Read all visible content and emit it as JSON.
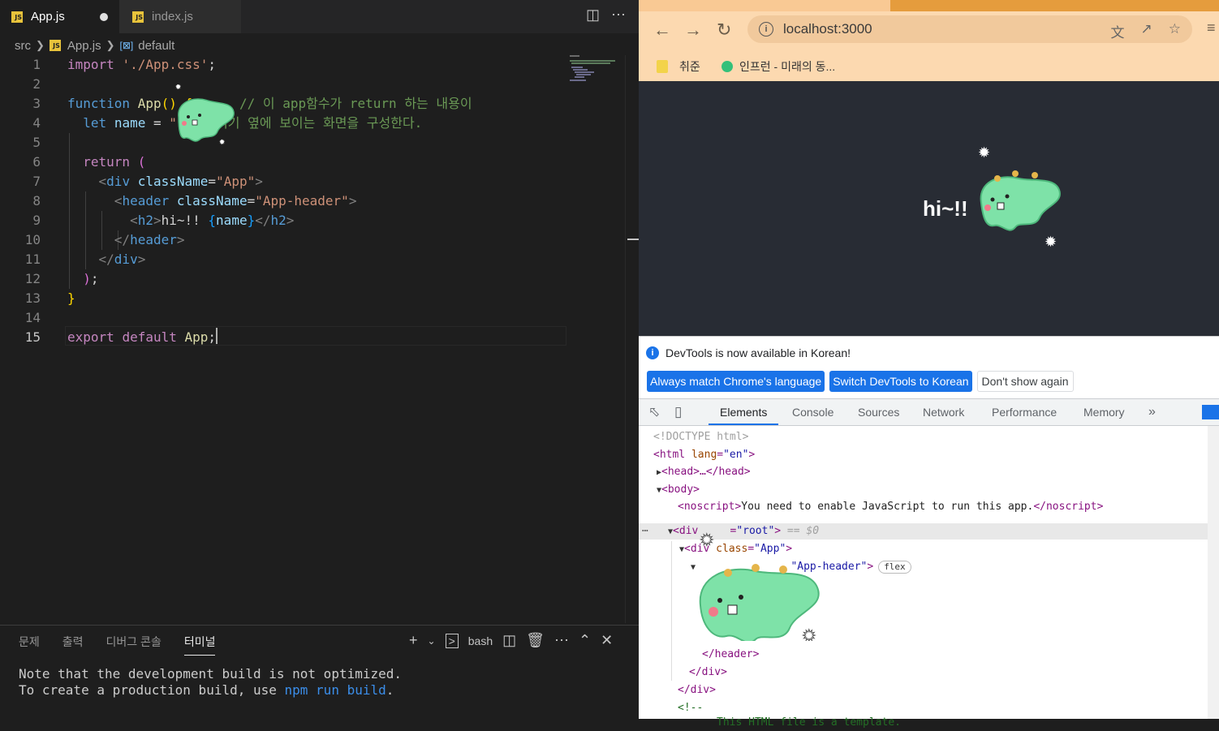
{
  "editor": {
    "tabs": [
      {
        "label": "App.js",
        "icon": "js-icon",
        "modified": true
      },
      {
        "label": "index.js",
        "icon": "js-icon",
        "modified": false
      }
    ],
    "breadcrumb": {
      "folder": "src",
      "file": "App.js",
      "symbol": "default"
    },
    "code_lines": [
      "import './App.css';",
      "",
      "function App() {      // 이 app함수가 return 하는 내용이",
      "  let name = \"\";// 여기 옆에 보이는 화면을 구성한다.",
      "",
      "  return (",
      "    <div className=\"App\">",
      "      <header className=\"App-header\">",
      "        <h2>hi~!! {name}</h2>",
      "      </header>",
      "    </div>",
      "  );",
      "}",
      "",
      "export default App;"
    ],
    "line_numbers": [
      "1",
      "2",
      "3",
      "4",
      "5",
      "6",
      "7",
      "8",
      "9",
      "10",
      "11",
      "12",
      "13",
      "14",
      "15"
    ],
    "current_line": "15"
  },
  "panel": {
    "tabs": [
      "문제",
      "출력",
      "디버그 콘솔",
      "터미널"
    ],
    "active_tab": "터미널",
    "shell": "bash",
    "terminal_line1": "Note that the development build is not optimized.",
    "terminal_line2_prefix": "To create a production build, use ",
    "terminal_line2_cmd": "npm run build",
    "terminal_line2_suffix": "."
  },
  "browser": {
    "url": "localhost:3000",
    "bookmarks": [
      "취준",
      "인프런 - 미래의 동..."
    ],
    "page_heading": "hi~!!"
  },
  "devtools": {
    "notice": "DevTools is now available in Korean!",
    "buttons": [
      "Always match Chrome's language",
      "Switch DevTools to Korean",
      "Don't show again"
    ],
    "tabs": [
      "Elements",
      "Console",
      "Sources",
      "Network",
      "Performance",
      "Memory"
    ],
    "active_tab": "Elements",
    "more": "»",
    "dom": {
      "doctype": "<!DOCTYPE html>",
      "html_open": "<html ",
      "html_attr": "lang",
      "html_val": "\"en\"",
      "head": "<head>…</head>",
      "body": "<body>",
      "noscript_open": "<noscript>",
      "noscript_text": "You need to enable JavaScript to run this app.",
      "noscript_close": "</noscript>",
      "root_open": "<div ",
      "root_val": "\"root\"",
      "root_marker": " == $0",
      "app_open": "<div ",
      "app_attr": "class",
      "app_val": "\"App\"",
      "header_val": "\"App-header\"",
      "flex_badge": "flex",
      "header_close": "</header>",
      "div_close1": "</div>",
      "div_close2": "</div>",
      "comment_open": "<!--",
      "comment_text": "This HTML file is a template."
    }
  },
  "colors": {
    "accent": "#1a73e8",
    "editor_bg": "#1e1e1e",
    "page_bg": "#282c34",
    "sticker": "#7ee2a8"
  }
}
